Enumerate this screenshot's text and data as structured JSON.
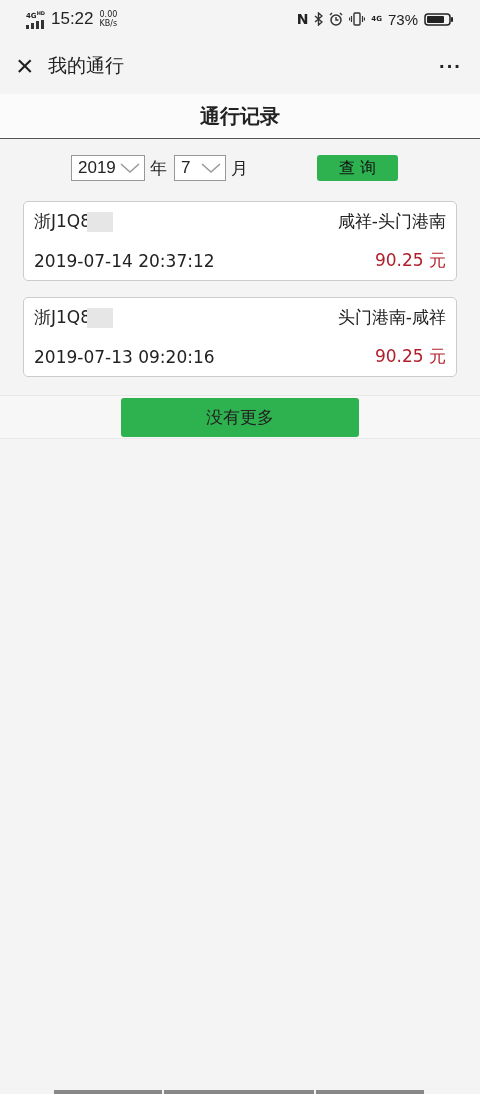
{
  "status_bar": {
    "network": "4G",
    "network_badge": "HD",
    "time": "15:22",
    "speed_value": "0.00",
    "speed_unit": "KB/s",
    "nfc": "N",
    "mobile": "4G",
    "battery": "73%"
  },
  "header": {
    "close": "×",
    "title": "我的通行",
    "more": "···"
  },
  "page_title": "通行记录",
  "filter": {
    "year": "2019",
    "year_unit": "年",
    "month": "7",
    "month_unit": "月",
    "query_button": "查 询"
  },
  "records": [
    {
      "plate": "浙J1Q8",
      "route": "咸祥-头门港南",
      "time": "2019-07-14 20:37:12",
      "amount": "90.25 元"
    },
    {
      "plate": "浙J1Q8",
      "route": "头门港南-咸祥",
      "time": "2019-07-13 09:20:16",
      "amount": "90.25 元"
    }
  ],
  "more_button": "没有更多"
}
